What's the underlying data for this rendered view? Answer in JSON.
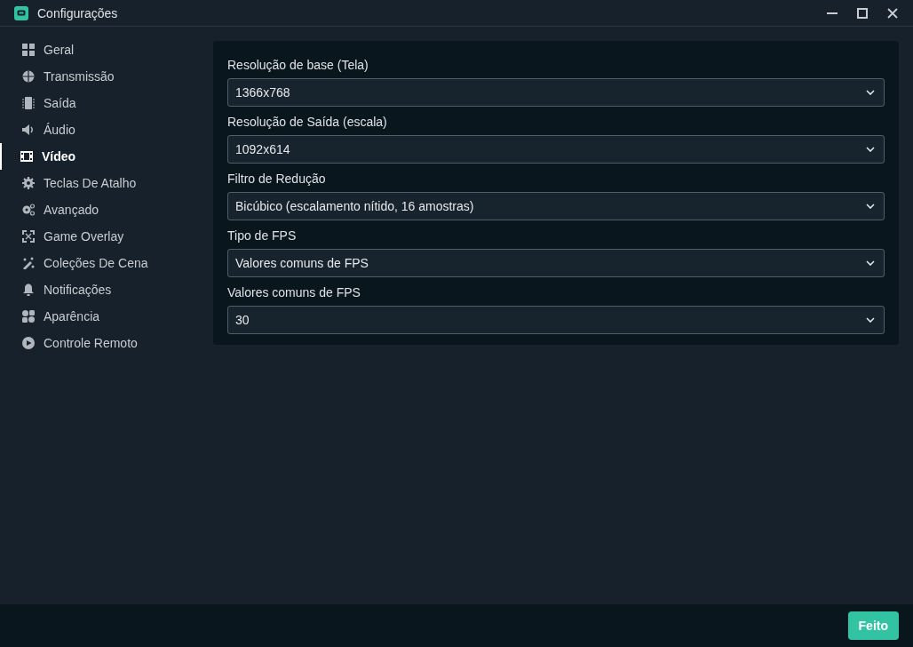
{
  "window": {
    "title": "Configurações"
  },
  "sidebar": {
    "items": [
      {
        "label": "Geral",
        "selected": false
      },
      {
        "label": "Transmissão",
        "selected": false
      },
      {
        "label": "Saída",
        "selected": false
      },
      {
        "label": "Áudio",
        "selected": false
      },
      {
        "label": "Vídeo",
        "selected": true
      },
      {
        "label": "Teclas De Atalho",
        "selected": false
      },
      {
        "label": "Avançado",
        "selected": false
      },
      {
        "label": "Game Overlay",
        "selected": false
      },
      {
        "label": "Coleções De Cena",
        "selected": false
      },
      {
        "label": "Notificações",
        "selected": false
      },
      {
        "label": "Aparência",
        "selected": false
      },
      {
        "label": "Controle Remoto",
        "selected": false
      }
    ]
  },
  "fields": [
    {
      "label": "Resolução de base (Tela)",
      "value": "1366x768"
    },
    {
      "label": "Resolução de Saída (escala)",
      "value": "1092x614"
    },
    {
      "label": "Filtro de Redução",
      "value": "Bicúbico (escalamento nítido, 16 amostras)"
    },
    {
      "label": "Tipo de FPS",
      "value": "Valores comuns de FPS"
    },
    {
      "label": "Valores comuns de FPS",
      "value": "30"
    }
  ],
  "footer": {
    "button": "Feito"
  }
}
